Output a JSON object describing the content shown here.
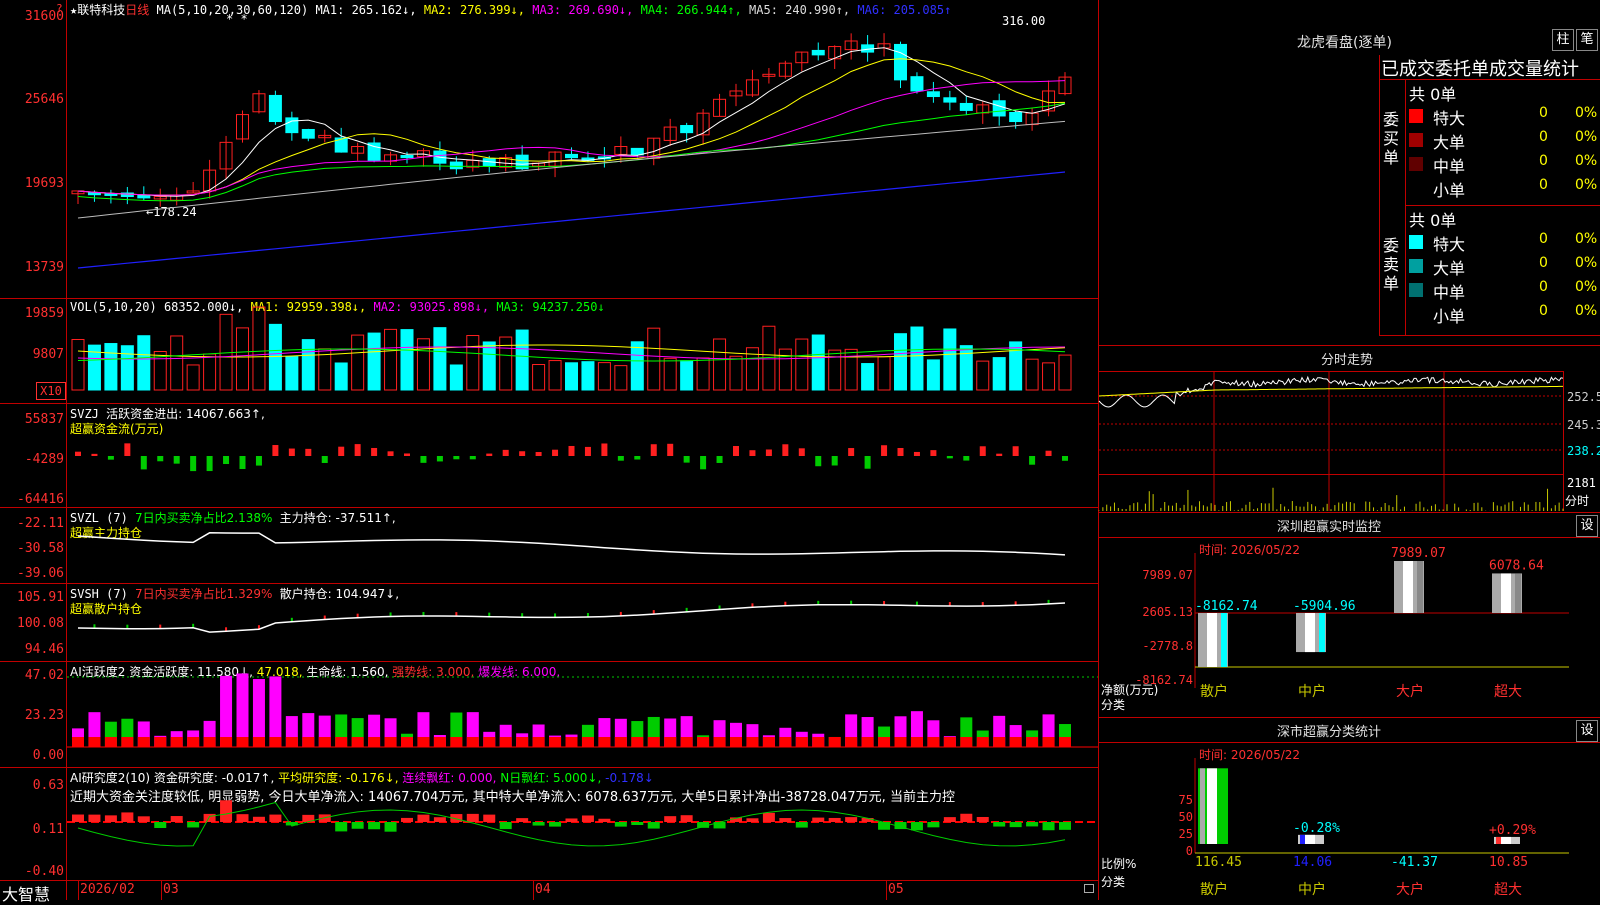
{
  "colors": {
    "up": "#ff2020",
    "down": "#00ffff",
    "grid": "#c00000",
    "bg": "#000000",
    "ma1": "#ffffff",
    "ma2": "#ffff00",
    "ma3": "#ff00ff",
    "ma4": "#00ff00",
    "ma5": "#bbbbbb",
    "ma6": "#2020ff"
  },
  "kline": {
    "star": "★",
    "stock_name": "联特科技",
    "period": "日线",
    "ma_params": "MA(5,10,20,30,60,120)",
    "ma1": "MA1: 265.162↓,",
    "ma2": "MA2: 276.399↓,",
    "ma3": "MA3: 269.690↓,",
    "ma4": "MA4: 266.944↑,",
    "ma5": "MA5: 240.990↑,",
    "ma6": "MA6: 205.085↑",
    "marks": "* *",
    "high_label": "316.00",
    "low_label": "←178.24",
    "y_ticks": [
      "31600",
      "25646",
      "19693",
      "13739"
    ]
  },
  "volume": {
    "title": "VOL(5,10,20)",
    "vol": "68352.000↓,",
    "ma1": "MA1: 92959.398↓,",
    "ma2": "MA2: 93025.898↓,",
    "ma3": "MA3: 94237.250↓",
    "y_ticks": [
      "19859",
      "9807"
    ],
    "unit": "X10"
  },
  "svzj": {
    "title": "SVZJ",
    "line1": "活跃资金进出: 14067.663↑,",
    "line2": "超赢资金流(万元)",
    "y_ticks": [
      "55837",
      "-4289",
      "-64416"
    ]
  },
  "svzl": {
    "title": "SVZL (7)",
    "line1": "7日内买卖净占比2.138%",
    "line1b": "主力持仓: -37.511↑,",
    "line2": "超赢主力持仓",
    "y_ticks": [
      "-22.11",
      "-30.58",
      "-39.06"
    ]
  },
  "svsh": {
    "title": "SVSH (7)",
    "line1": "7日内买卖净占比1.329%",
    "line1b": "散户持仓: 104.947↓,",
    "line2": "超赢散户持仓",
    "y_ticks": [
      "105.91",
      "100.08",
      "94.46"
    ]
  },
  "ai_active": {
    "title": "AI活跃度2",
    "a": "资金活跃度: 11.580↓,",
    "b": "47.018,",
    "c": "生命线: 1.560,",
    "d": "强势线: 3.000,",
    "e": "爆发线: 6.000,",
    "y_ticks": [
      "47.02",
      "23.23",
      "0.00"
    ]
  },
  "ai_research": {
    "title": "AI研究度2(10)",
    "a": "资金研究度: -0.017↑,",
    "b": "平均研究度: -0.176↓,",
    "c": "连续飘红: 0.000,",
    "d": "N日飘红: 5.000↓,",
    "e": "-0.178↓",
    "desc": "近期大资金关注度较低, 明显弱势, 今日大单净流入: 14067.704万元, 其中特大单净流入: 6078.637万元, 大单5日累计净出-38728.047万元, 当前主力控",
    "y_ticks": [
      "0.63",
      "0.11",
      "-0.40"
    ]
  },
  "bottom_axis": {
    "brand": "大智慧",
    "labels": [
      "2026/02",
      "03",
      "04",
      "05"
    ]
  },
  "dragon_tiger": {
    "title": "龙虎看盘(逐单)",
    "btn1": "柱",
    "btn2": "笔",
    "tabs": "已成交委托单成交量统计",
    "buy_side": "委买单",
    "sell_side": "委卖单",
    "buy_total": "共 0单",
    "sell_total": "共 0单",
    "buy_rows": [
      {
        "label": "特大",
        "value": "0",
        "pct": "0%",
        "color": "#ff0000"
      },
      {
        "label": "大单",
        "value": "0",
        "pct": "0%",
        "color": "#a00000"
      },
      {
        "label": "中单",
        "value": "0",
        "pct": "0%",
        "color": "#600000"
      },
      {
        "label": "小单",
        "value": "0",
        "pct": "0%",
        "color": ""
      }
    ],
    "sell_rows": [
      {
        "label": "特大",
        "value": "0",
        "pct": "0%",
        "color": "#00ffff"
      },
      {
        "label": "大单",
        "value": "0",
        "pct": "0%",
        "color": "#00a0a0"
      },
      {
        "label": "中单",
        "value": "0",
        "pct": "0%",
        "color": "#007070"
      },
      {
        "label": "小单",
        "value": "0",
        "pct": "0%",
        "color": ""
      }
    ]
  },
  "intraday": {
    "title": "分时走势",
    "y_ticks": [
      "252.5",
      "245.3",
      "238.2",
      "2181",
      "分时"
    ]
  },
  "sz_monitor": {
    "title": "深圳超赢实时监控",
    "btn": "设",
    "time": "时间: 2026/05/22",
    "y_ticks": [
      "7989.07",
      "2605.13",
      "-2778.8",
      "-8162.74"
    ],
    "y_label1": "净额(万元)",
    "y_label2": "分类",
    "bars": [
      {
        "cat": "散户",
        "value": -8162.74,
        "label": "-8162.74"
      },
      {
        "cat": "中户",
        "value": -5904.96,
        "label": "-5904.96"
      },
      {
        "cat": "大户",
        "value": 7989.07,
        "label": "7989.07"
      },
      {
        "cat": "超大",
        "value": 6078.64,
        "label": "6078.64"
      }
    ]
  },
  "sz_class": {
    "title": "深市超赢分类统计",
    "btn": "设",
    "time": "时间: 2026/05/22",
    "y_ticks": [
      "75",
      "50",
      "25",
      "0"
    ],
    "y_label1": "比例%",
    "y_label2": "分类",
    "bars": [
      {
        "cat": "散户",
        "value": 116.45,
        "label": "116.45",
        "pct": ""
      },
      {
        "cat": "中户",
        "value": 14.06,
        "label": "14.06",
        "pct": "-0.28%"
      },
      {
        "cat": "大户",
        "value": -41.37,
        "label": "-41.37",
        "pct": ""
      },
      {
        "cat": "超大",
        "value": 10.85,
        "label": "10.85",
        "pct": "+0.29%"
      }
    ]
  },
  "chart_data": {
    "type": "bar",
    "title": "深圳超赢实时监控",
    "categories": [
      "散户",
      "中户",
      "大户",
      "超大"
    ],
    "series": [
      {
        "name": "净额(万元)",
        "values": [
          -8162.74,
          -5904.96,
          7989.07,
          6078.64
        ]
      }
    ],
    "ylim": [
      -8162.74,
      7989.07
    ],
    "ylabel": "净额(万元)",
    "xlabel": "分类"
  }
}
